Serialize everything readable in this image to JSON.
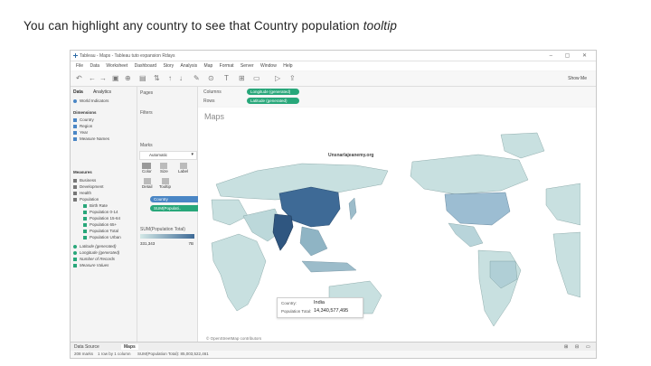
{
  "caption": {
    "text": "You can highlight any country to see that Country population ",
    "emphasis": "tooltip"
  },
  "window": {
    "title": "Tableau - Maps - Tableau tuto expansion Rdays",
    "controls": "– ▢ ✕"
  },
  "menu": [
    "File",
    "Data",
    "Worksheet",
    "Dashboard",
    "Story",
    "Analysis",
    "Map",
    "Format",
    "Server",
    "Window",
    "Help"
  ],
  "toolbar": {
    "show_me": "Show Me"
  },
  "sidebar": {
    "tab_data": "Data",
    "tab_analytics": "Analytics",
    "datasource": "World Indicators",
    "dimensions_header": "Dimensions",
    "dimensions": [
      "Country",
      "Region",
      "Year",
      "Measure Names"
    ],
    "measures_header": "Measures",
    "measures": [
      "Business",
      "Development",
      "Health",
      "Population",
      "Birth Rate",
      "Population 0-14",
      "Population 15-64",
      "Population 65+",
      "Population Total",
      "Population Urban",
      "Latitude (generated)",
      "Longitude (generated)",
      "Number of Records",
      "Measure Values"
    ]
  },
  "cards": {
    "pages": "Pages",
    "filters": "Filters",
    "marks": "Marks",
    "mark_type": "Automatic",
    "color": "Color",
    "size": "Size",
    "label": "Label",
    "detail": "Detail",
    "tooltip": "Tooltip",
    "pill_country": "Country",
    "pill_sum": "SUM(Populati..",
    "legend_title": "SUM(Population Total)",
    "legend_min": "331,343",
    "legend_max": "7B"
  },
  "shelves": {
    "columns_label": "Columns",
    "columns_pill": "Longitude (generated)",
    "rows_label": "Rows",
    "rows_pill": "Latitude (generated)"
  },
  "view": {
    "title": "Maps",
    "watermark": "Unsnarlajeanemy.org",
    "attribution": "© OpenStreetMap contributors"
  },
  "tooltip": {
    "country_label": "Country:",
    "country_value": "India",
    "population_label": "Population Total:",
    "population_value": "14,340,577,495"
  },
  "tabs": {
    "data_source": "Data Source",
    "sheet": "Maps"
  },
  "status": {
    "marks": "208 marks",
    "rows_cols": "1 row by 1 column",
    "sum": "SUM(Population Total): 85,003,522,461"
  },
  "colors": {
    "accent_green": "#28a77a",
    "pill_blue": "#4a86c5",
    "map_light": "#c8e0e0",
    "map_dark": "#3e6a96"
  }
}
